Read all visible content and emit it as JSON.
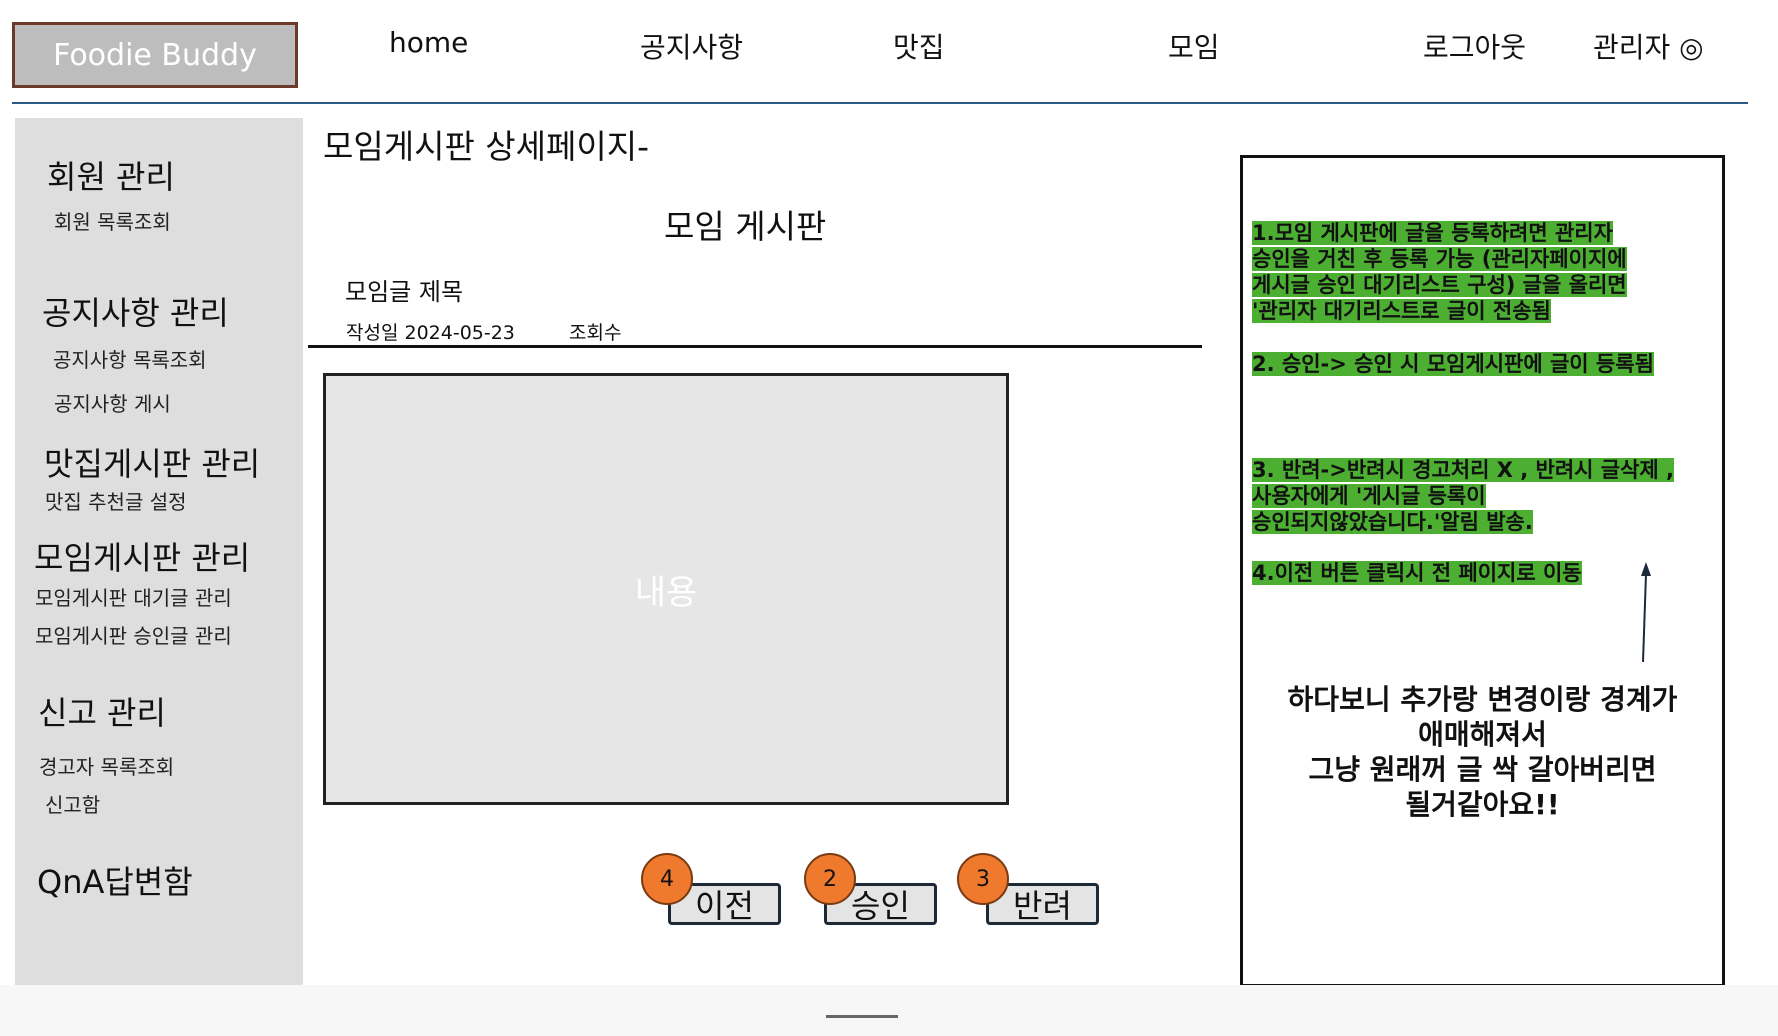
{
  "header": {
    "logo": "Foodie Buddy",
    "nav": [
      {
        "label": "home"
      },
      {
        "label": "공지사항"
      },
      {
        "label": "맛집"
      },
      {
        "label": "모임"
      },
      {
        "label": "로그아웃"
      },
      {
        "label": "관리자 ◎"
      }
    ]
  },
  "sidebar": {
    "sections": [
      {
        "title": "회원 관리",
        "items": [
          "회원 목록조회"
        ]
      },
      {
        "title": "공지사항 관리",
        "items": [
          "공지사항 목록조회",
          "공지사항 게시"
        ]
      },
      {
        "title": "맛집게시판 관리",
        "items": [
          "맛집 추천글 설정"
        ]
      },
      {
        "title": "모임게시판 관리",
        "items": [
          "모임게시판 대기글 관리",
          "모임게시판 승인글 관리"
        ]
      },
      {
        "title": "신고 관리",
        "items": [
          "경고자 목록조회",
          "신고함"
        ]
      },
      {
        "title": "QnA답변함",
        "items": []
      }
    ]
  },
  "main": {
    "page_title": "모임게시판 상세페이지-",
    "board_title": "모임 게시판",
    "post_title": "모임글 제목",
    "date_label": "작성일 2024-05-23",
    "views_label": "조회수",
    "content": "내용",
    "buttons": [
      {
        "label": "이전",
        "badge": "4"
      },
      {
        "label": "승인",
        "badge": "2"
      },
      {
        "label": "반려",
        "badge": "3"
      }
    ]
  },
  "notes": {
    "note1": [
      "1.모임 게시판에 글을 등록하려면 관리자",
      "승인을 거친 후 등록 가능 (관리자페이지에",
      "게시글 승인 대기리스트 구성) 글을 올리면",
      "'관리자 대기리스트로 글이 전송됨"
    ],
    "note2": [
      "2. 승인-> 승인 시 모임게시판에 글이 등록됨"
    ],
    "note3": [
      "3. 반려->반려시 경고처리 X , 반려시 글삭제 ,",
      "사용자에게 '게시글 등록이",
      "승인되지않았습니다.'알림 발송."
    ],
    "note4": [
      "4.이전 버튼 클릭시 전 페이지로 이동"
    ],
    "remark": [
      "하다보니 추가랑 변경이랑 경계가",
      "애매해져서",
      "그냥 원래꺼 글 싹 갈아버리면",
      "될거같아요!!"
    ]
  },
  "colors": {
    "highlight": "#4caf32",
    "badge": "#ef7a2e",
    "header_line": "#2a5b86",
    "logo_border": "#6b3a2a"
  }
}
